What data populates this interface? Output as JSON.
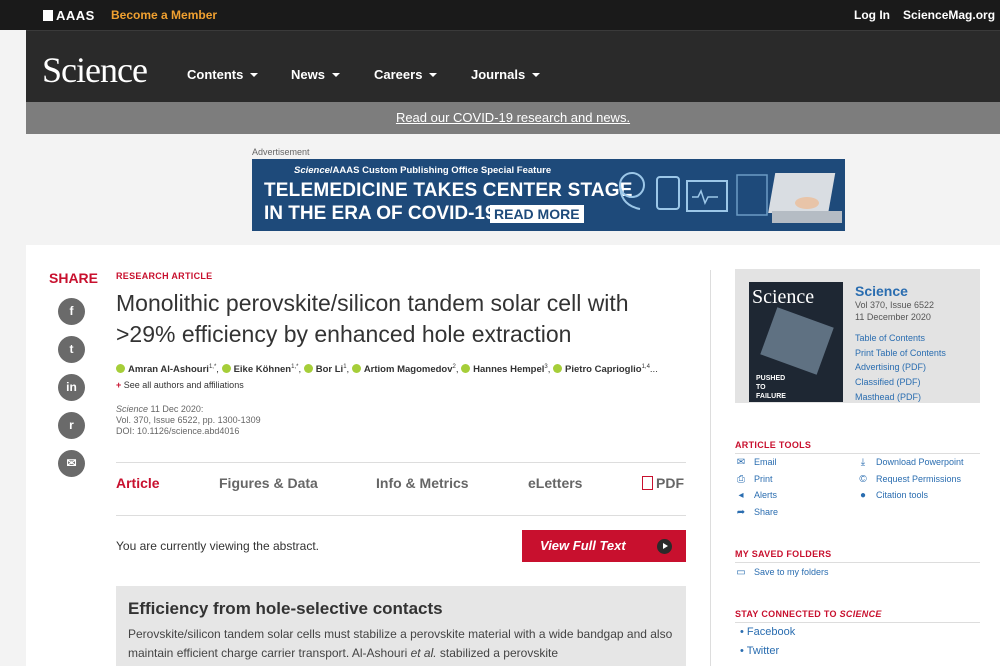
{
  "topbar": {
    "brand": "AAAS",
    "become": "Become a Member",
    "login": "Log In",
    "site": "ScienceMag.org"
  },
  "nav": {
    "logo": "Science",
    "items": [
      "Contents",
      "News",
      "Careers",
      "Journals"
    ]
  },
  "banner": {
    "covid": "Read our COVID-19 research and news."
  },
  "ad": {
    "label": "Advertisement",
    "sub_italic": "Science",
    "sub": "/AAAS Custom Publishing Office Special Feature",
    "line1": "TELEMEDICINE TAKES CENTER STAGE",
    "line2": "IN THE ERA OF COVID-19",
    "readmore": "READ MORE"
  },
  "share": {
    "label": "SHARE",
    "icons": [
      "facebook-icon",
      "twitter-icon",
      "linkedin-icon",
      "reddit-icon",
      "email-icon"
    ]
  },
  "article": {
    "type": "RESEARCH ARTICLE",
    "title": "Monolithic perovskite/silicon tandem solar cell with >29% efficiency by enhanced hole extraction",
    "authors": [
      {
        "name": "Amran Al-Ashouri",
        "sup": "1,*"
      },
      {
        "name": "Eike Köhnen",
        "sup": "1,*"
      },
      {
        "name": "Bor Li",
        "sup": "1"
      },
      {
        "name": "Artiom Magomedov",
        "sup": "2"
      },
      {
        "name": "Hannes Hempel",
        "sup": "3"
      },
      {
        "name": "Pietro Caprioglio",
        "sup": "1,4"
      }
    ],
    "authors_more": "...",
    "see_all": "See all authors and affiliations",
    "journal": "Science",
    "date": " 11 Dec 2020:",
    "volume": "Vol. 370, Issue 6522, pp. 1300-1309",
    "doi": "DOI: 10.1126/science.abd4016"
  },
  "tabs": {
    "article": "Article",
    "figures": "Figures & Data",
    "info": "Info & Metrics",
    "eletters": "eLetters",
    "pdf": "PDF"
  },
  "viewing": "You are currently viewing the abstract.",
  "fulltext": "View Full Text",
  "abstract": {
    "heading": "Efficiency from hole-selective contacts",
    "text1": "Perovskite/silicon tandem solar cells must stabilize a perovskite material with a wide bandgap and also maintain efficient charge carrier transport. Al-Ashouri ",
    "text_italic": "et al.",
    "text2": " stabilized a perovskite"
  },
  "issue": {
    "title": "Science",
    "vol": "Vol 370, Issue 6522",
    "date": "11 December 2020",
    "links": [
      "Table of Contents",
      "Print Table of Contents",
      "Advertising (PDF)",
      "Classified (PDF)",
      "Masthead (PDF)"
    ],
    "cover_logo": "Science",
    "cover_text": "PUSHED TO FAILURE"
  },
  "tools": {
    "heading": "ARTICLE TOOLS",
    "left": [
      "Email",
      "Print",
      "Alerts",
      "Share"
    ],
    "right": [
      "Download Powerpoint",
      "Request Permissions",
      "Citation tools"
    ]
  },
  "saved": {
    "heading": "MY SAVED FOLDERS",
    "link": "Save to my folders"
  },
  "connected": {
    "heading": "STAY CONNECTED TO ",
    "heading_italic": "SCIENCE",
    "links": [
      "Facebook",
      "Twitter"
    ]
  },
  "colors": {
    "accent": "#c8102e",
    "link": "#2a6db0",
    "header": "#1a1a1a",
    "orcid": "#a6ce39"
  }
}
